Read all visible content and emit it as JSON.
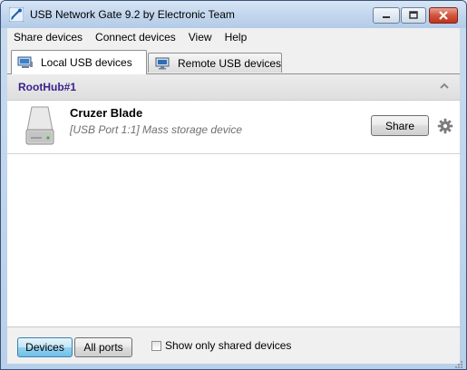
{
  "window": {
    "title": "USB Network Gate 9.2 by Electronic Team",
    "app_icon": "usb-network-gate-logo-icon",
    "controls": [
      "minimize-icon",
      "maximize-icon",
      "close-icon"
    ]
  },
  "menubar": {
    "items": [
      "Share devices",
      "Connect devices",
      "View",
      "Help"
    ]
  },
  "tabs": [
    {
      "label": "Local USB devices",
      "icon": "local-computer-icon",
      "active": true
    },
    {
      "label": "Remote USB devices",
      "icon": "remote-monitor-icon",
      "active": false
    }
  ],
  "hub": {
    "title": "RootHub#1",
    "collapse_icon": "chevron-up-icon",
    "title_color": "#3b1f8e"
  },
  "devices": [
    {
      "name": "Cruzer Blade",
      "description": "[USB Port 1:1] Mass storage device",
      "icon": "external-drive-icon",
      "action_label": "Share",
      "settings_icon": "gear-icon"
    }
  ],
  "bottombar": {
    "devices_label": "Devices",
    "all_ports_label": "All ports",
    "show_shared_label": "Show only shared devices",
    "show_shared_checked": false,
    "active_view": "Devices"
  }
}
